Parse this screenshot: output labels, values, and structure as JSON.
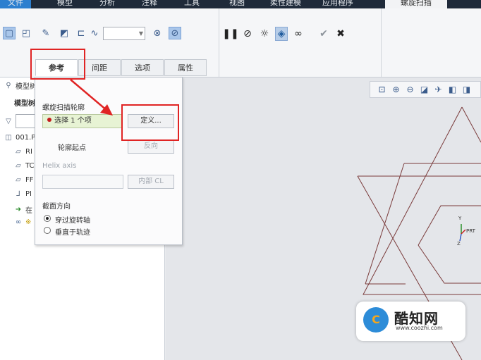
{
  "menu": {
    "tabs": [
      "文件",
      "模型",
      "分析",
      "注释",
      "工具",
      "视图",
      "柔性建模",
      "应用程序",
      "螺旋扫描"
    ]
  },
  "ribbon": {
    "dropdown_value": ""
  },
  "subtabs": [
    "参考",
    "间距",
    "选项",
    "属性"
  ],
  "left_panel": {
    "header": "模型树",
    "model_label": "模型树",
    "tree": [
      "001.P",
      "RI",
      "TC",
      "FF",
      "PI",
      "在",
      "※"
    ]
  },
  "popup": {
    "profile_label": "螺旋扫描轮廓",
    "selection_text": "选择 1 个项",
    "define_button": "定义...",
    "start_label": "轮廓起点",
    "reverse_button": "反向",
    "helix_label": "Helix axis",
    "internal_button": "内部 CL",
    "section_label": "截面方向",
    "option_through": "穿过旋转轴",
    "option_normal": "垂直于轨迹"
  },
  "csys": {
    "y": "Y",
    "z": "Z",
    "name": "PRT"
  },
  "watermark": {
    "brand": "酷知网",
    "url": "www.coozhi.com",
    "logo_letters": "C"
  },
  "colors": {
    "annotation_red": "#e02424",
    "profile_line": "#7a3b3b"
  }
}
